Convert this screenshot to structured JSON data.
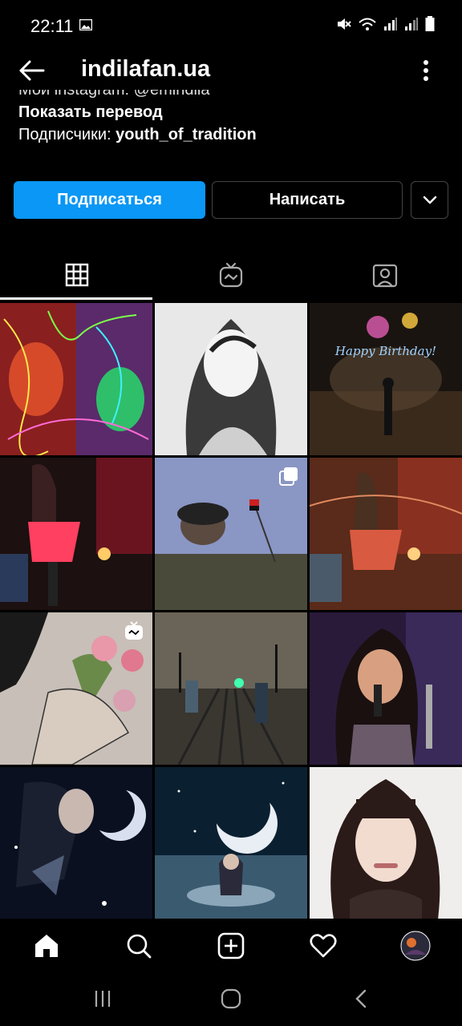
{
  "status": {
    "time": "22:11"
  },
  "header": {
    "title": "indilafan.ua"
  },
  "bio": {
    "cut_line": "Мой instagram: @emindila",
    "translate_label": "Показать перевод",
    "followers_label": "Подписчики:",
    "followers_user": "youth_of_tradition"
  },
  "actions": {
    "follow_label": "Подписаться",
    "message_label": "Написать"
  },
  "colors": {
    "accent": "#0a97f5",
    "background": "#000000"
  },
  "tabs": [
    {
      "icon": "grid-icon",
      "selected": true
    },
    {
      "icon": "igtv-icon",
      "selected": false
    },
    {
      "icon": "tagged-icon",
      "selected": false
    }
  ],
  "grid_badges": {
    "tile_5": "carousel-icon",
    "tile_7": "igtv-icon"
  },
  "overlay_text": {
    "birthday": "Happy Birthday!"
  },
  "bottom_nav": [
    "home-icon",
    "search-icon",
    "add-icon",
    "heart-icon",
    "profile-avatar"
  ]
}
